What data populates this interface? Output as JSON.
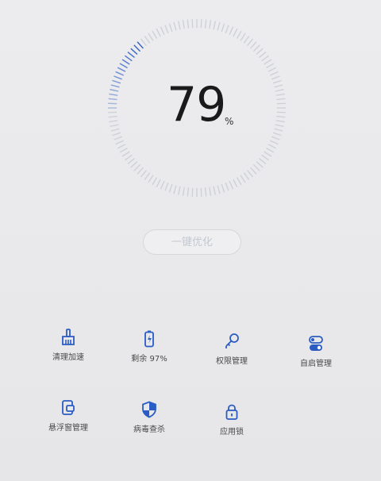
{
  "score": {
    "value": "79",
    "unit": "%"
  },
  "optimize_button": {
    "label": "一键优化"
  },
  "tools": [
    {
      "label": "清理加速",
      "icon": "broom-icon"
    },
    {
      "label": "剩余 97%",
      "icon": "battery-icon"
    },
    {
      "label": "权限管理",
      "icon": "key-icon"
    },
    {
      "label": "自启管理",
      "icon": "toggle-icon"
    },
    {
      "label": "悬浮窗管理",
      "icon": "floating-window-icon"
    },
    {
      "label": "病毒查杀",
      "icon": "shield-icon"
    },
    {
      "label": "应用锁",
      "icon": "lock-icon"
    }
  ],
  "colors": {
    "accent": "#2a5cc4",
    "tick_inactive": "#c9ccd3",
    "text_primary": "#1a1a1a"
  }
}
